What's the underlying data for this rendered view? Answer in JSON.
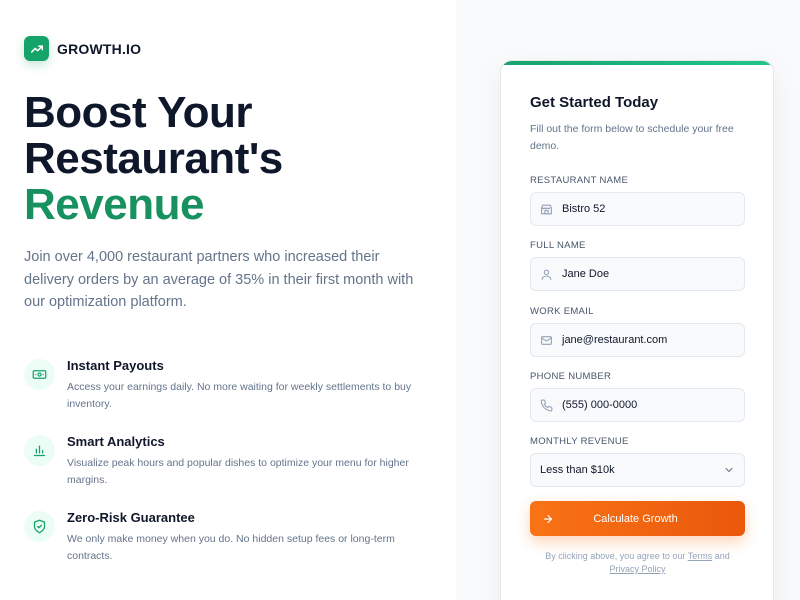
{
  "brand": {
    "name": "GROWTH.IO",
    "accent": "#16a36a",
    "icon": "trending-up-icon"
  },
  "hero": {
    "title_line1": "Boost Your",
    "title_line2": "Restaurant's",
    "title_accent": "Revenue",
    "description": "Join over 4,000 restaurant partners who increased their delivery orders by an average of 35% in their first month with our optimization platform."
  },
  "features": [
    {
      "icon": "money-icon",
      "title": "Instant Payouts",
      "text": "Access your earnings daily. No more waiting for weekly settlements to buy inventory."
    },
    {
      "icon": "bar-chart-icon",
      "title": "Smart Analytics",
      "text": "Visualize peak hours and popular dishes to optimize your menu for higher margins."
    },
    {
      "icon": "shield-check-icon",
      "title": "Zero-Risk Guarantee",
      "text": "We only make money when you do. No hidden setup fees or long-term contracts."
    }
  ],
  "form": {
    "title": "Get Started Today",
    "subtitle": "Fill out the form below to schedule your free demo.",
    "fields": {
      "restaurant": {
        "label": "RESTAURANT NAME",
        "value": "Bistro 52",
        "icon": "store-icon"
      },
      "name": {
        "label": "FULL NAME",
        "value": "Jane Doe",
        "icon": "user-icon"
      },
      "email": {
        "label": "WORK EMAIL",
        "value": "jane@restaurant.com",
        "icon": "mail-icon"
      },
      "phone": {
        "label": "PHONE NUMBER",
        "value": "(555) 000-0000",
        "icon": "phone-icon"
      },
      "revenue": {
        "label": "MONTHLY REVENUE",
        "value": "Less than $10k",
        "icon": "chevron-down-icon"
      }
    },
    "submit_label": "Calculate Growth",
    "cta_color": "#f97316",
    "legal_prefix": "By clicking above, you agree to our",
    "legal_terms": "Terms",
    "legal_and": "and",
    "legal_privacy": "Privacy Policy"
  }
}
